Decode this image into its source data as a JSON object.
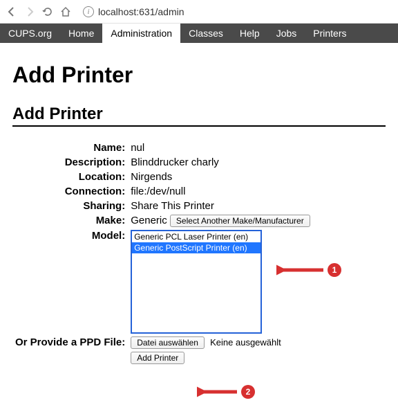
{
  "browser": {
    "url": "localhost:631/admin"
  },
  "nav": {
    "tabs": [
      "CUPS.org",
      "Home",
      "Administration",
      "Classes",
      "Help",
      "Jobs",
      "Printers"
    ],
    "active": "Administration"
  },
  "page": {
    "main_title": "Add Printer",
    "sub_title": "Add Printer"
  },
  "form": {
    "name_label": "Name:",
    "name_value": "nul",
    "description_label": "Description:",
    "description_value": "Blinddrucker charly",
    "location_label": "Location:",
    "location_value": "Nirgends",
    "connection_label": "Connection:",
    "connection_value": "file:/dev/null",
    "sharing_label": "Sharing:",
    "sharing_value": "Share This Printer",
    "make_label": "Make:",
    "make_value": "Generic",
    "make_button": "Select Another Make/Manufacturer",
    "model_label": "Model:",
    "model_options": [
      "Generic PCL Laser Printer (en)",
      "Generic PostScript Printer (en)"
    ],
    "model_selected_index": 1,
    "ppd_label": "Or Provide a PPD File:",
    "file_button": "Datei auswählen",
    "file_status": "Keine ausgewählt",
    "submit_button": "Add Printer"
  },
  "annotations": {
    "a1": "1",
    "a2": "2"
  }
}
